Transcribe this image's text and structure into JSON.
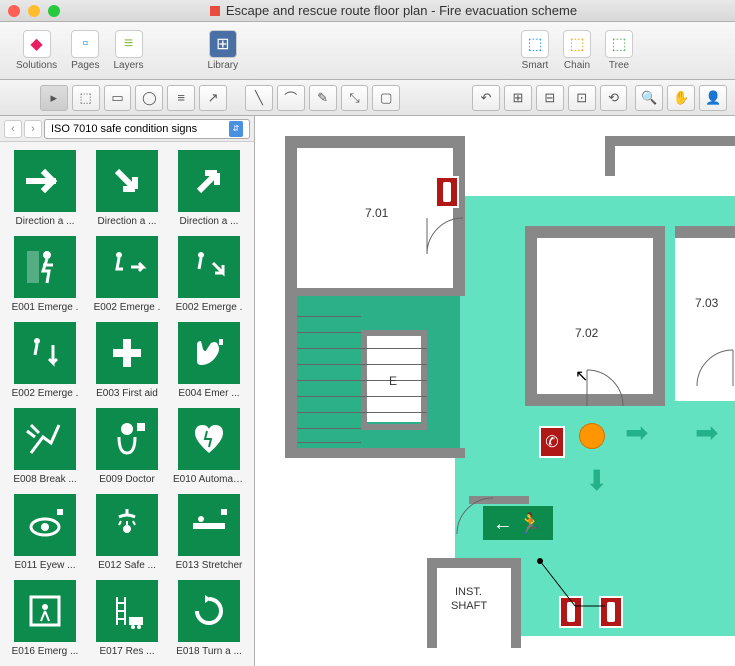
{
  "window": {
    "title": "Escape and rescue route floor plan - Fire evacuation scheme"
  },
  "toolbar": {
    "solutions": "Solutions",
    "pages": "Pages",
    "layers": "Layers",
    "library": "Library",
    "smart": "Smart",
    "chain": "Chain",
    "tree": "Tree"
  },
  "sidebar": {
    "dropdown": "ISO 7010 safe condition signs"
  },
  "signs": [
    {
      "label": "Direction a ...",
      "k": "arr-r"
    },
    {
      "label": "Direction a ...",
      "k": "arr-dr"
    },
    {
      "label": "Direction a ...",
      "k": "arr-ur"
    },
    {
      "label": "E001 Emerge .",
      "k": "exit"
    },
    {
      "label": "E002 Emerge .",
      "k": "exit-r"
    },
    {
      "label": "E002 Emerge .",
      "k": "exit-dr"
    },
    {
      "label": "E002 Emerge .",
      "k": "exit-d"
    },
    {
      "label": "E003 First aid",
      "k": "cross"
    },
    {
      "label": "E004 Emer ...",
      "k": "phone"
    },
    {
      "label": "E008 Break ...",
      "k": "break"
    },
    {
      "label": "E009 Doctor",
      "k": "doctor"
    },
    {
      "label": "E010 Automat ...",
      "k": "aed"
    },
    {
      "label": "E011 Eyew ...",
      "k": "eye"
    },
    {
      "label": "E012 Safe ...",
      "k": "shower"
    },
    {
      "label": "E013 Stretcher",
      "k": "stretch"
    },
    {
      "label": "E016 Emerg ...",
      "k": "window"
    },
    {
      "label": "E017 Res ...",
      "k": "ladder"
    },
    {
      "label": "E018 Turn a ...",
      "k": "turn"
    }
  ],
  "rooms": {
    "r701": "7.01",
    "r702": "7.02",
    "r703": "7.03",
    "inst": "INST.",
    "shaft": "SHAFT",
    "e": "E"
  }
}
